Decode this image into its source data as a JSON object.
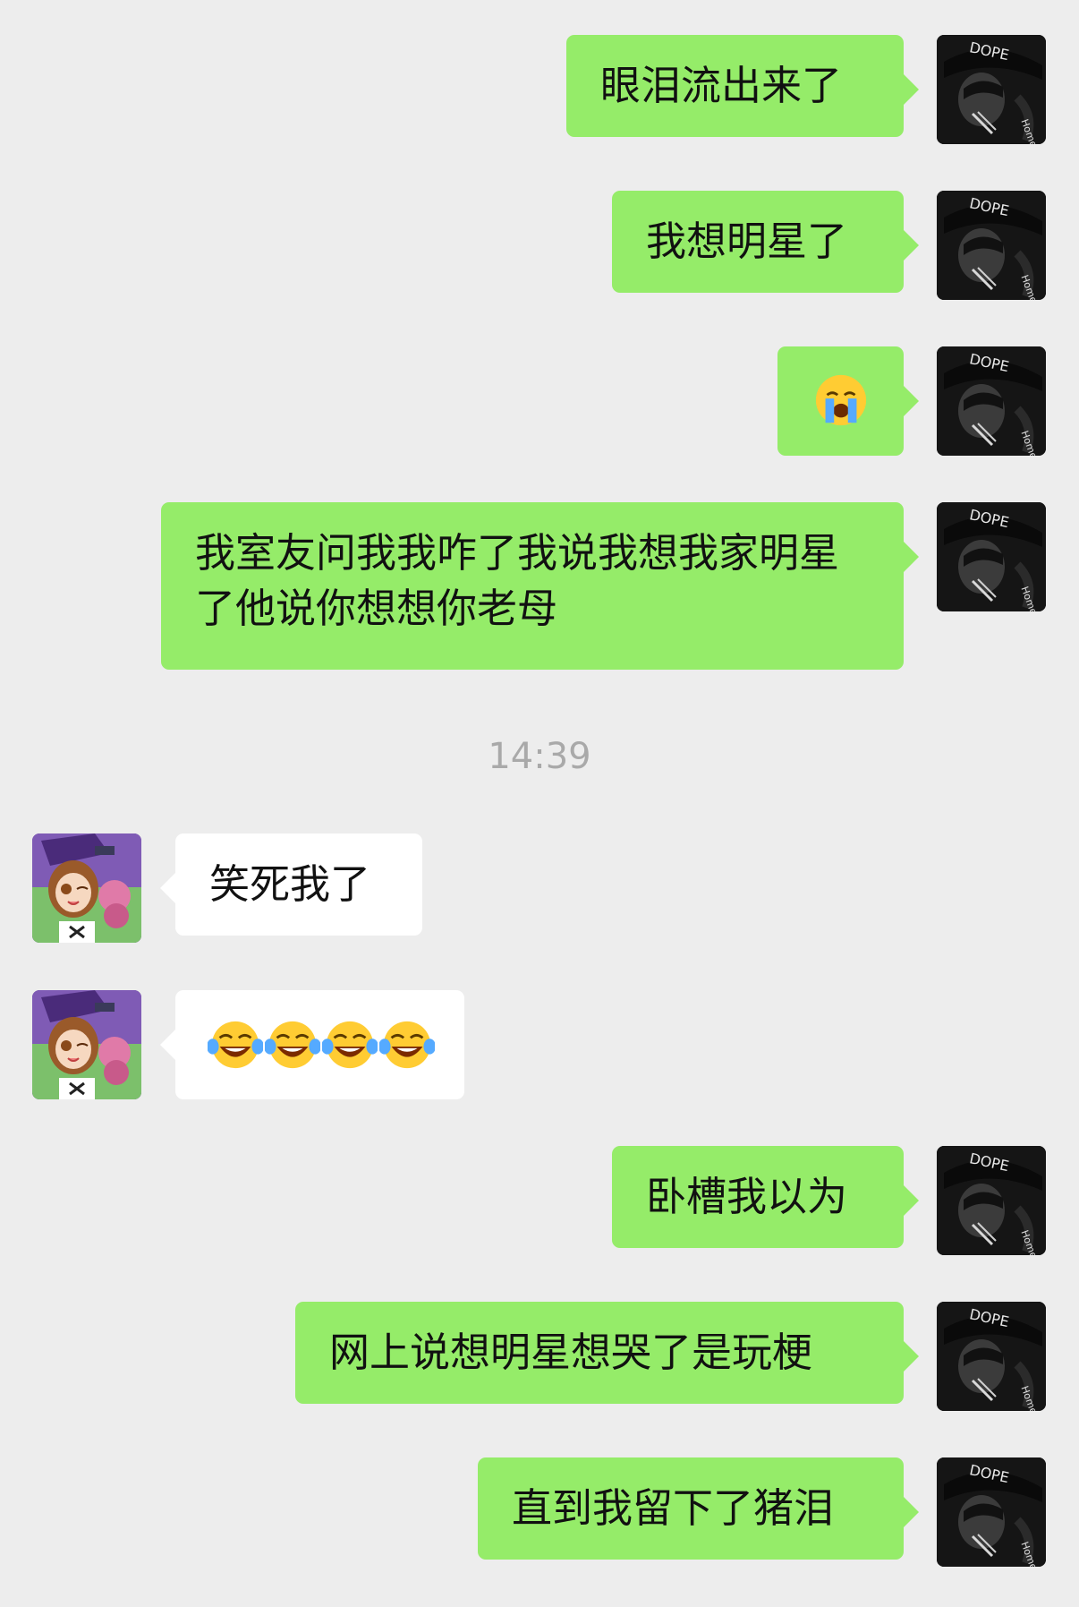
{
  "timestamp": "14:39",
  "messages": [
    {
      "text": "眼泪流出来了"
    },
    {
      "text": "我想明星了"
    },
    {
      "text": ""
    },
    {
      "text": "我室友问我我咋了我说我想我家明星了他说你想想你老母"
    },
    {
      "text": "笑死我了"
    },
    {
      "text": ""
    },
    {
      "text": "卧槽我以为"
    },
    {
      "text": "网上说想明星想哭了是玩梗"
    },
    {
      "text": "直到我留下了猪泪"
    }
  ],
  "emoji": {
    "crying": "loudly-crying-face",
    "laughing": "face-with-tears-of-joy"
  },
  "colors": {
    "sent_bubble": "#95ec69",
    "received_bubble": "#ffffff",
    "background": "#ededed"
  }
}
